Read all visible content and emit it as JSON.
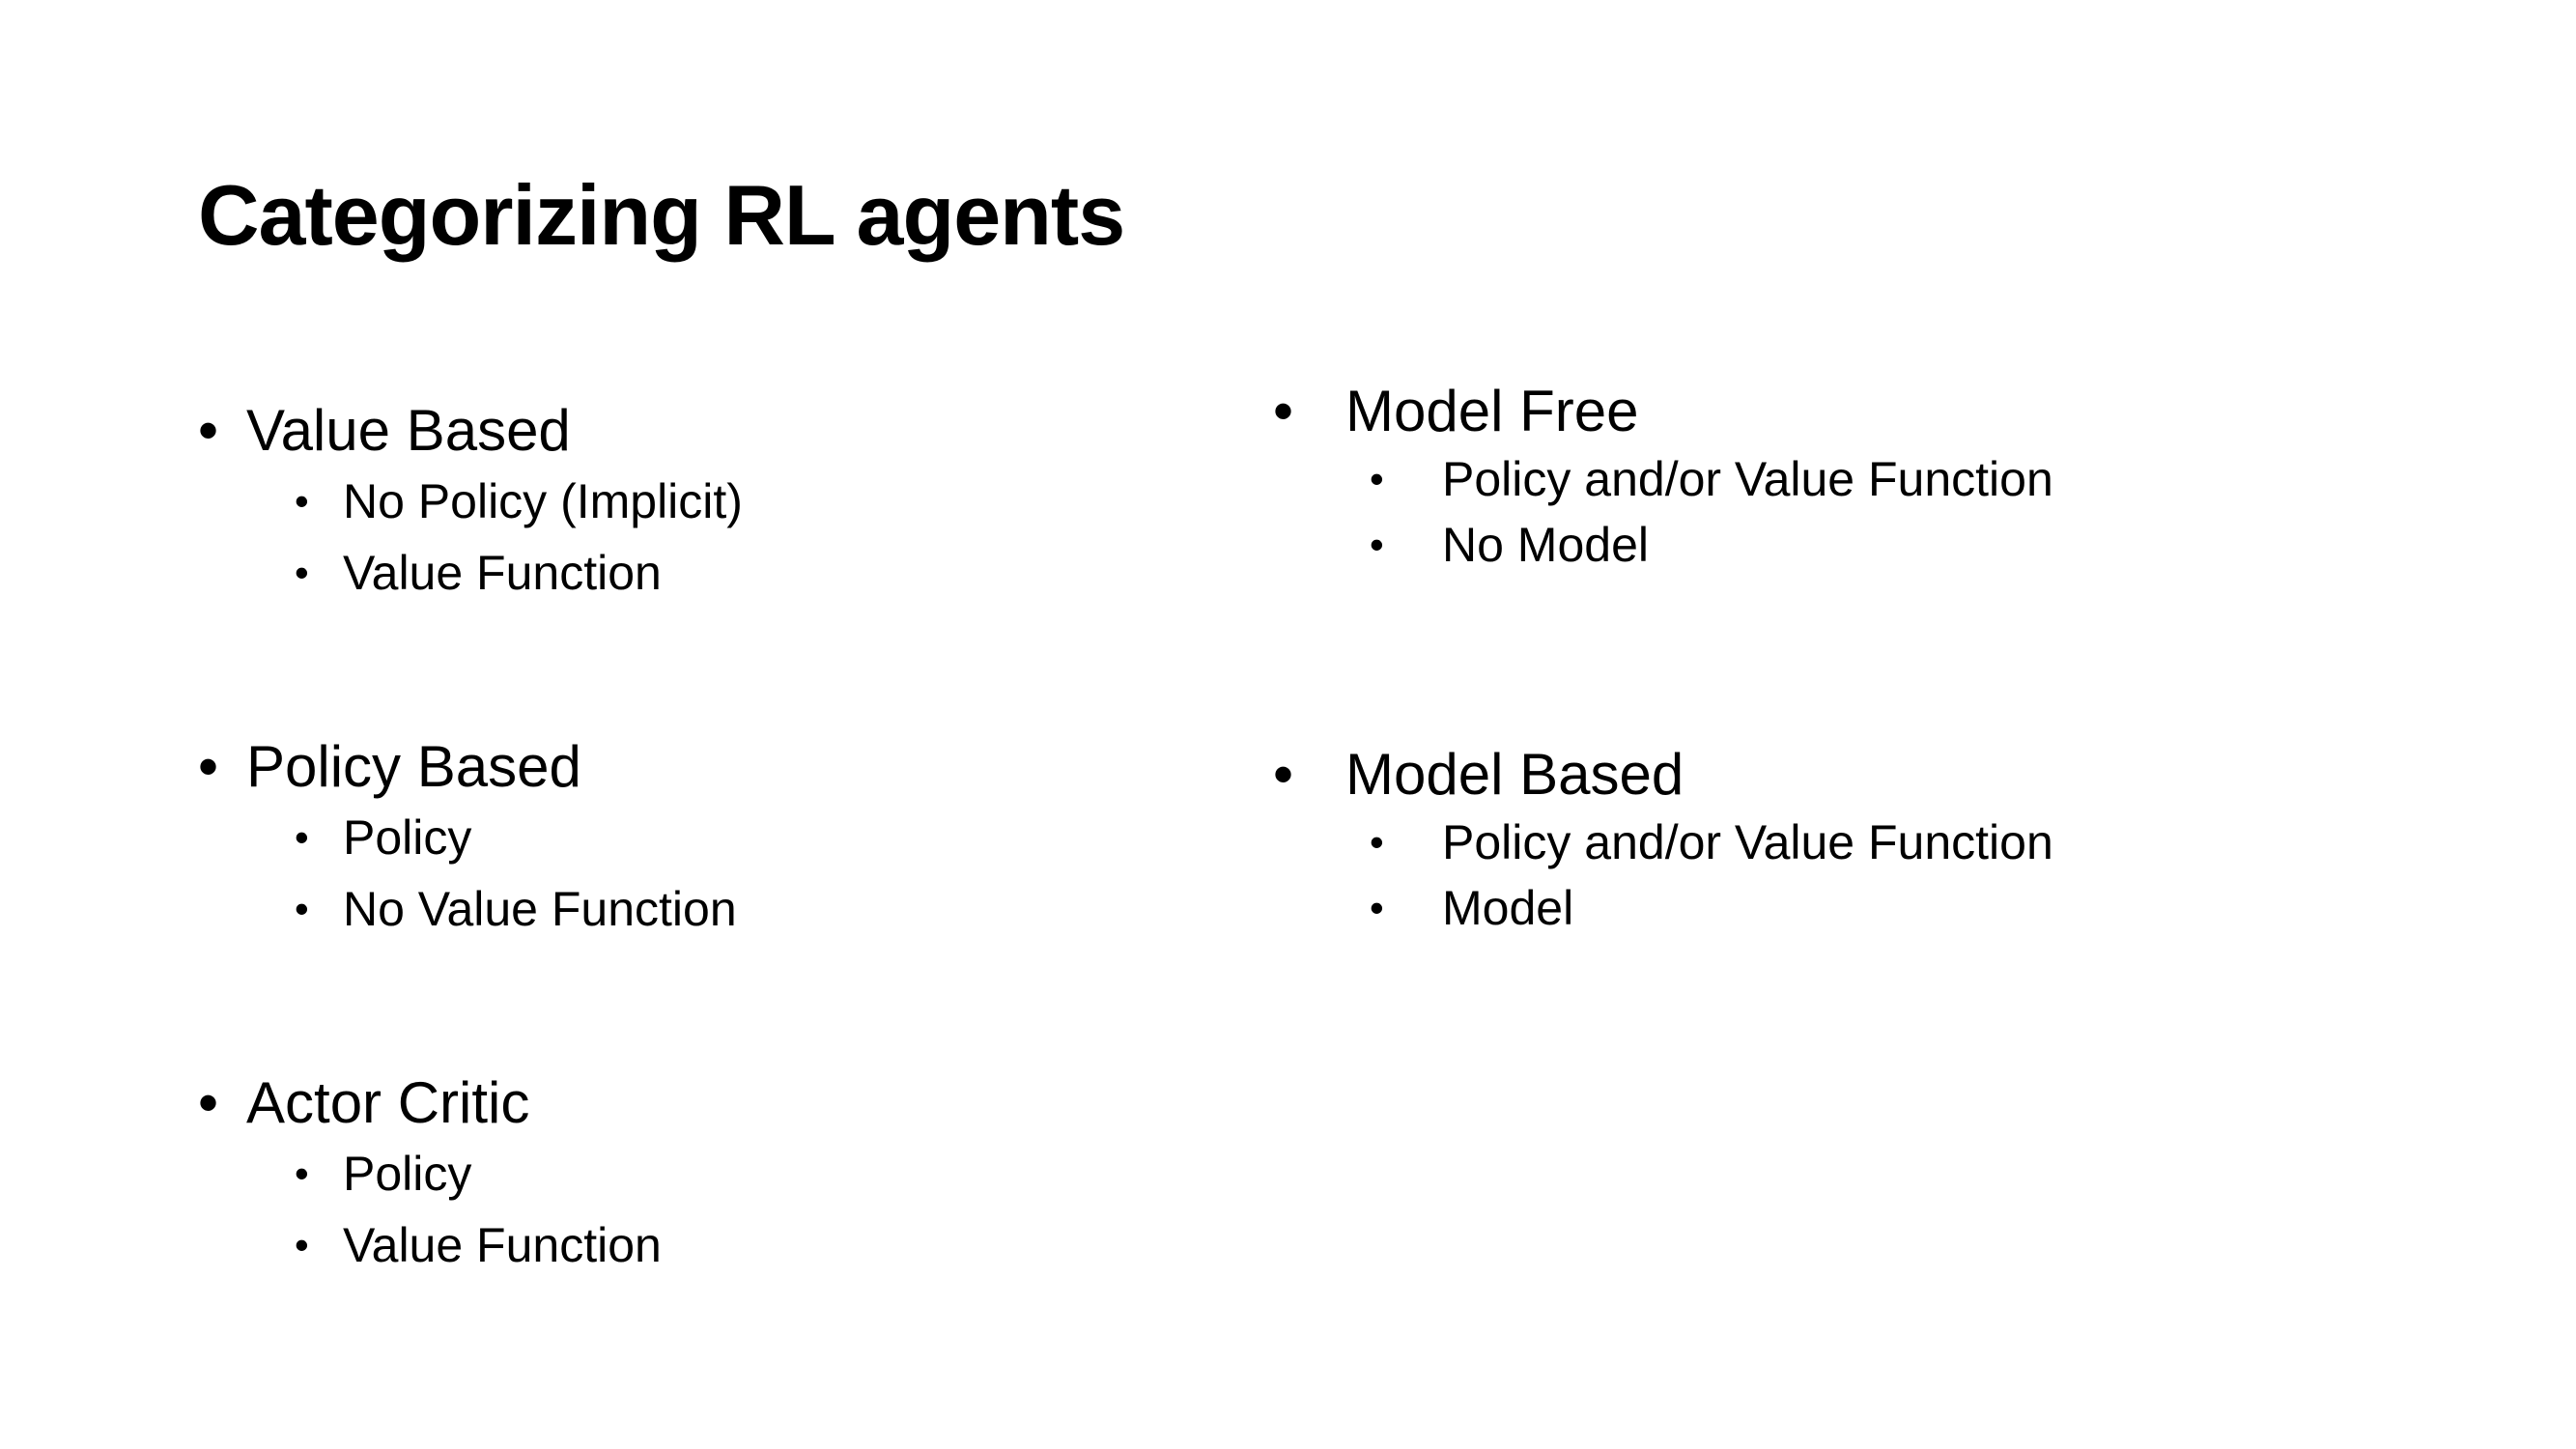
{
  "slide": {
    "title": "Categorizing RL agents",
    "bullet": "•",
    "left_column": [
      {
        "label": "Value Based",
        "items": [
          "No Policy (Implicit)",
          "Value Function"
        ]
      },
      {
        "label": "Policy Based",
        "items": [
          "Policy",
          "No Value Function"
        ]
      },
      {
        "label": "Actor Critic",
        "items": [
          "Policy",
          "Value Function"
        ]
      }
    ],
    "right_column": [
      {
        "label": "Model Free",
        "items": [
          "Policy and/or Value Function",
          "No Model"
        ]
      },
      {
        "label": "Model Based",
        "items": [
          "Policy and/or Value Function",
          "Model"
        ]
      }
    ]
  }
}
